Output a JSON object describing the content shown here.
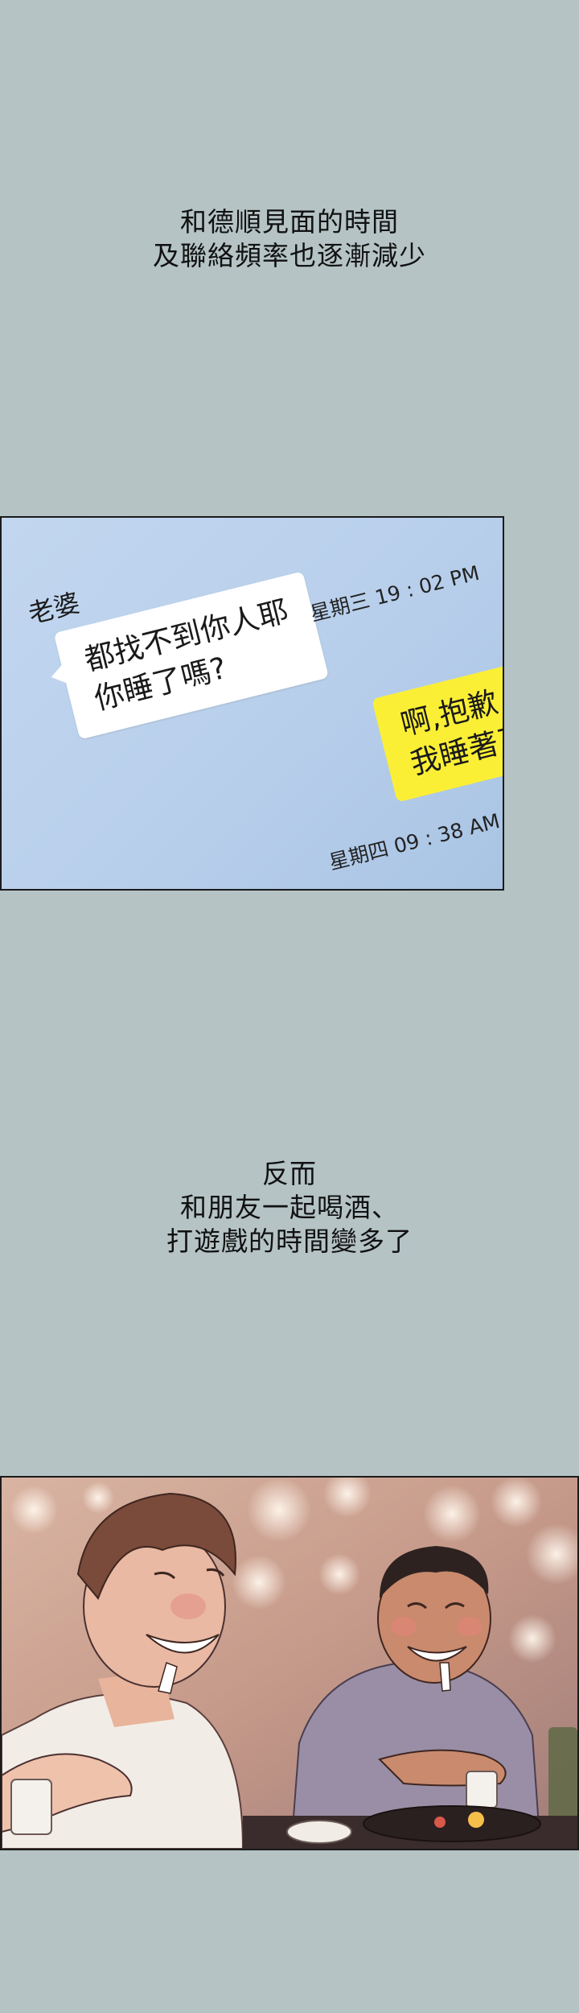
{
  "caption_1": {
    "line_1": "和德順見面的時間",
    "line_2": "及聯絡頻率也逐漸減少"
  },
  "chat": {
    "contact_name": "老婆",
    "incoming_line_1": "都找不到你人耶",
    "incoming_line_2": "你睡了嗎?",
    "incoming_time": "星期三 19 : 02 PM",
    "outgoing_line_1": "啊,抱歉",
    "outgoing_line_2": "我睡著了",
    "outgoing_time": "星期四 09 : 38 AM",
    "colors": {
      "incoming_bubble": "#ffffff",
      "outgoing_bubble": "#fbef36",
      "screen": "#bcd2ed"
    }
  },
  "caption_2": {
    "line_1": "反而",
    "line_2": "和朋友一起喝酒、",
    "line_3": "打遊戲的時間變多了"
  },
  "colors": {
    "page_background": "#b5c3c5"
  }
}
